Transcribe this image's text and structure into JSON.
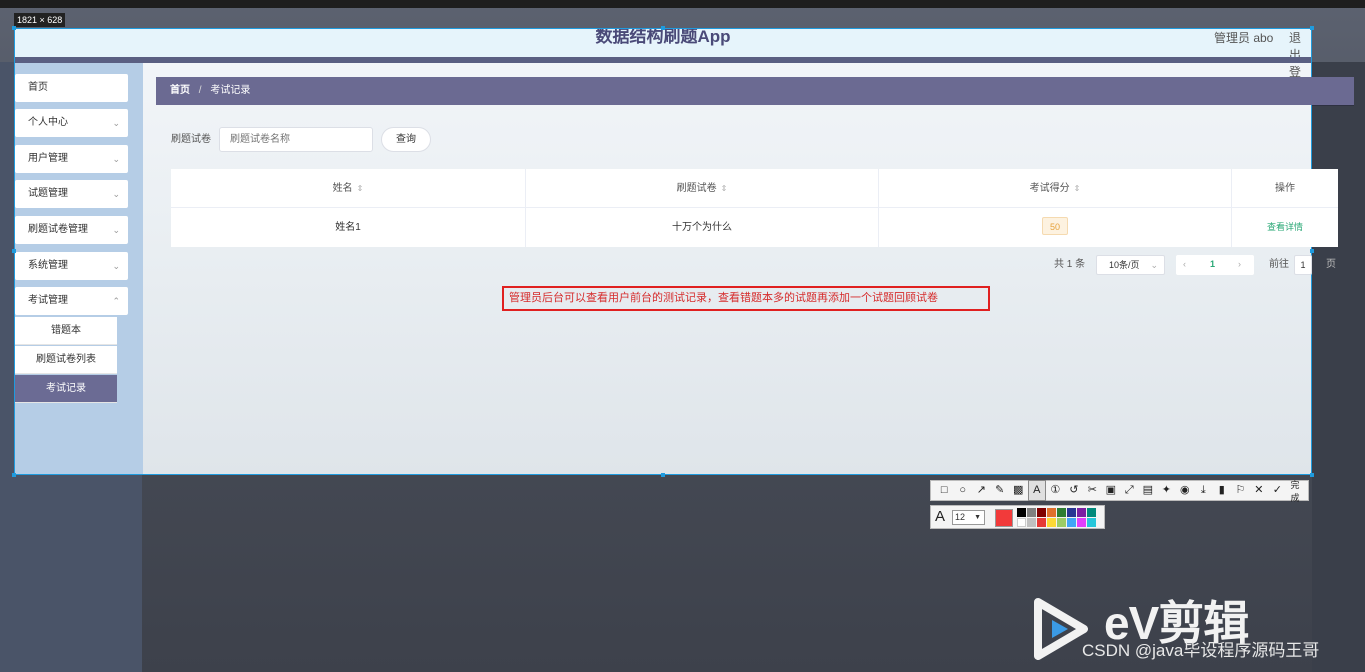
{
  "overlay": {
    "dimensions_label": "1821 × 628"
  },
  "header": {
    "title": "数据结构刷题App",
    "admin": "管理员 abo",
    "logout": "退出登录"
  },
  "sidebar": {
    "items": [
      {
        "label": "首页"
      },
      {
        "label": "个人中心"
      },
      {
        "label": "用户管理"
      },
      {
        "label": "试题管理"
      },
      {
        "label": "刷题试卷管理"
      },
      {
        "label": "系统管理"
      },
      {
        "label": "考试管理"
      }
    ],
    "sub_items": [
      {
        "label": "错题本"
      },
      {
        "label": "刷题试卷列表"
      },
      {
        "label": "考试记录"
      }
    ]
  },
  "breadcrumb": {
    "home": "首页",
    "separator": "/",
    "current": "考试记录"
  },
  "search": {
    "label": "刷题试卷",
    "placeholder": "刷题试卷名称",
    "button": "查询"
  },
  "table": {
    "columns": [
      "姓名",
      "刷题试卷",
      "考试得分",
      "操作"
    ],
    "rows": [
      {
        "name": "姓名1",
        "paper": "十万个为什么",
        "score": "50",
        "action": "查看详情"
      }
    ]
  },
  "pagination": {
    "total": "共 1 条",
    "page_size": "10条/页",
    "current_page": "1",
    "goto_label": "前往",
    "goto_value": "1",
    "page_unit": "页"
  },
  "annotation": {
    "text": "管理员后台可以查看用户前台的测试记录，查看错题本多的试题再添加一个试题回顾试卷"
  },
  "capture_toolbar": {
    "done_label": "完成",
    "font_size": "12",
    "current_color": "#f23a3a"
  },
  "watermark": {
    "brand": "eV剪辑",
    "csdn": "CSDN @java毕设程序源码王哥"
  }
}
